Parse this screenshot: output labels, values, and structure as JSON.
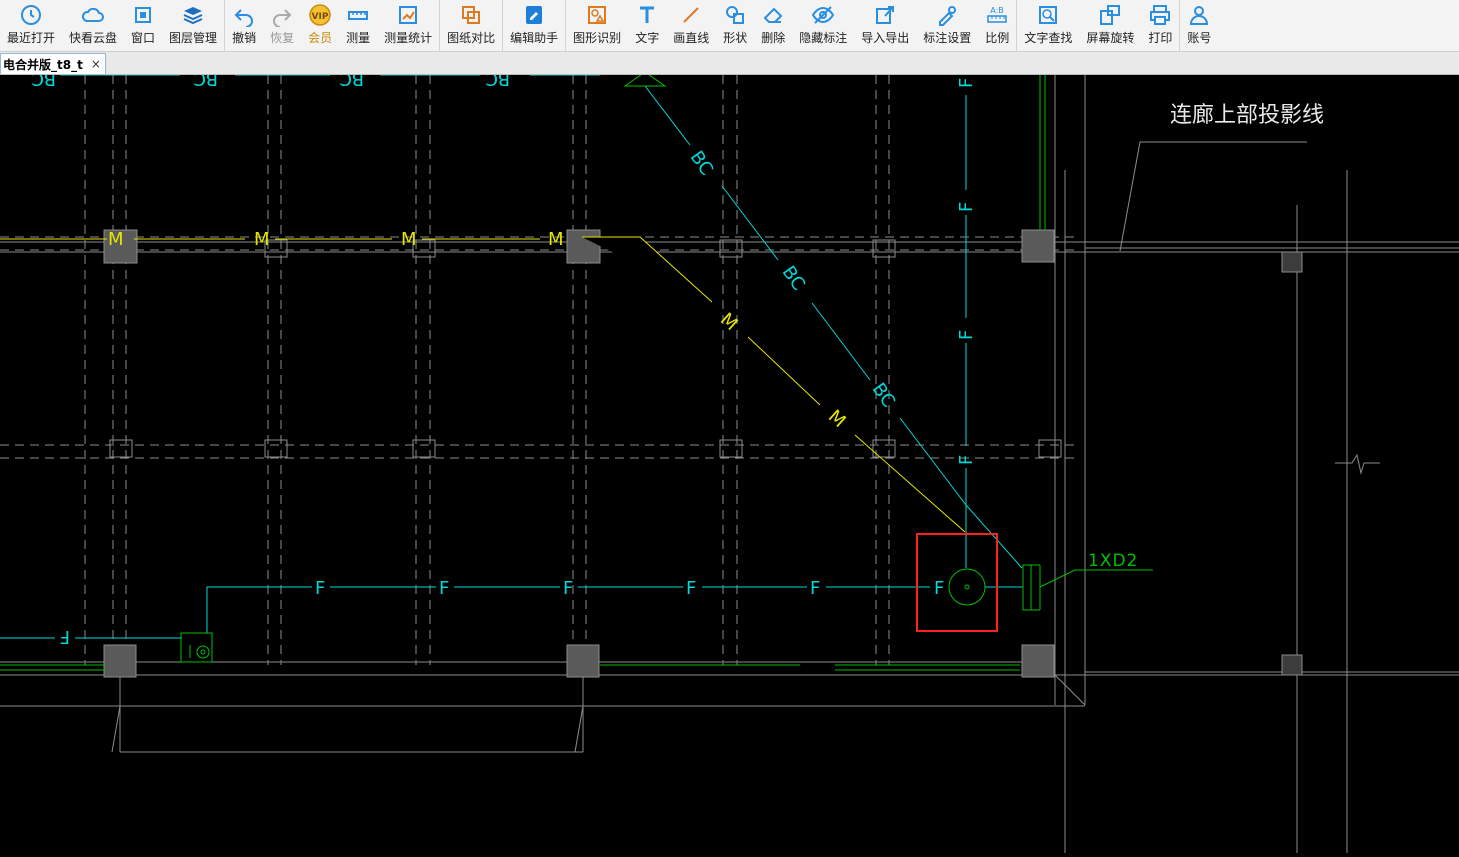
{
  "toolbar": {
    "groups": [
      [
        {
          "id": "recent",
          "label": "最近打开",
          "icon": "clock-icon"
        },
        {
          "id": "cloud",
          "label": "快看云盘",
          "icon": "cloud-icon"
        },
        {
          "id": "window",
          "label": "窗口",
          "icon": "window-icon"
        },
        {
          "id": "layers",
          "label": "图层管理",
          "icon": "layers-icon"
        }
      ],
      [
        {
          "id": "undo",
          "label": "撤销",
          "icon": "undo-icon"
        },
        {
          "id": "redo",
          "label": "恢复",
          "icon": "redo-icon",
          "disabled": true
        },
        {
          "id": "vip",
          "label": "会员",
          "icon": "vip-icon",
          "vip": true
        },
        {
          "id": "measure",
          "label": "测量",
          "icon": "ruler-icon"
        },
        {
          "id": "measure-stats",
          "label": "测量统计",
          "icon": "chart-icon"
        }
      ],
      [
        {
          "id": "compare",
          "label": "图纸对比",
          "icon": "compare-icon"
        }
      ],
      [
        {
          "id": "edit-helper",
          "label": "编辑助手",
          "icon": "edit-helper-icon"
        }
      ],
      [
        {
          "id": "shape-recog",
          "label": "图形识别",
          "icon": "shape-recognize-icon"
        },
        {
          "id": "text",
          "label": "文字",
          "icon": "text-icon"
        },
        {
          "id": "line",
          "label": "画直线",
          "icon": "line-icon"
        },
        {
          "id": "shape",
          "label": "形状",
          "icon": "shapes-icon"
        },
        {
          "id": "delete",
          "label": "删除",
          "icon": "eraser-icon"
        },
        {
          "id": "hide-mark",
          "label": "隐藏标注",
          "icon": "eye-off-icon"
        },
        {
          "id": "import-export",
          "label": "导入导出",
          "icon": "export-icon"
        },
        {
          "id": "mark-settings",
          "label": "标注设置",
          "icon": "settings-icon"
        },
        {
          "id": "scale",
          "label": "比例",
          "icon": "scale-icon"
        }
      ],
      [
        {
          "id": "text-search",
          "label": "文字查找",
          "icon": "text-search-icon"
        },
        {
          "id": "rotate",
          "label": "屏幕旋转",
          "icon": "rotate-icon"
        },
        {
          "id": "print",
          "label": "打印",
          "icon": "printer-icon"
        }
      ],
      [
        {
          "id": "account",
          "label": "账号",
          "icon": "user-icon"
        }
      ]
    ]
  },
  "tab": {
    "title": "电合并版_t8_t",
    "close": "×"
  },
  "drawing": {
    "title_annotation": "连廊上部投影线",
    "equipment_label": "1XD2",
    "wire_labels": {
      "m": "M",
      "bc": "BC",
      "f": "F"
    }
  },
  "colors": {
    "background": "#000000",
    "cyan": "#00d8d8",
    "yellow": "#e6e600",
    "green": "#00c000",
    "grey_line": "#8c8c8c",
    "white": "#ffffff",
    "highlight": "#ff2020",
    "column_fill": "#5a5a5a"
  }
}
